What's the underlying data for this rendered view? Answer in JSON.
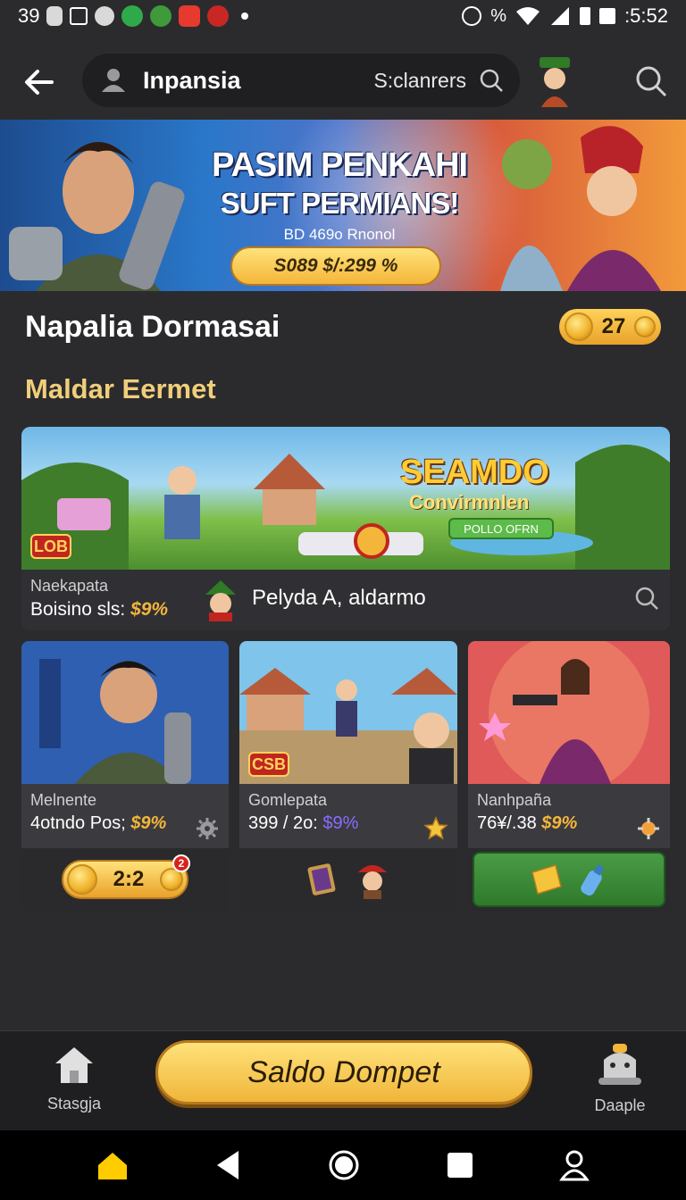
{
  "status_bar": {
    "left_text": "39",
    "time": ":5:52"
  },
  "top_bar": {
    "title": "Inpansia",
    "subtitle": "S:clanrers"
  },
  "hero": {
    "title_line1": "PASIM PENKAHI",
    "title_line2": "SUFT PERMIANS!",
    "subtitle": "BD 469o Rnonol",
    "cta": "S089 $/:299 %"
  },
  "header": {
    "name": "Napalia Dormasai",
    "coins": "27"
  },
  "section": {
    "title": "Maldar Eermet"
  },
  "featured": {
    "art_title": "SEAMDO",
    "art_subtitle": "Convirmnlen",
    "art_button": "POLLO OFRN",
    "badge": "LOB",
    "label": "Naekapata",
    "bonus_prefix": "Boisino sls:",
    "bonus_value": "$9%",
    "description": "Pelyda A, aldarmo"
  },
  "cards": [
    {
      "name": "Melnente",
      "bonus_prefix": "4otndo Pos;",
      "bonus_value": "$9%",
      "coin_value": "2:2",
      "notif": "2"
    },
    {
      "name": "Gomlepata",
      "bonus_prefix": "399 / 2o:",
      "bonus_value": "$9%",
      "badge": "CSB"
    },
    {
      "name": "Nanhpaña",
      "bonus_prefix": "76¥/.38",
      "bonus_value": "$9%"
    }
  ],
  "bottom": {
    "home_label": "Stasgja",
    "saldo_label": "Saldo Dompet",
    "right_label": "Daaple"
  },
  "colors": {
    "accent_gold": "#f4b63a",
    "section_title": "#f0cf7a",
    "background": "#2b2b2e"
  }
}
